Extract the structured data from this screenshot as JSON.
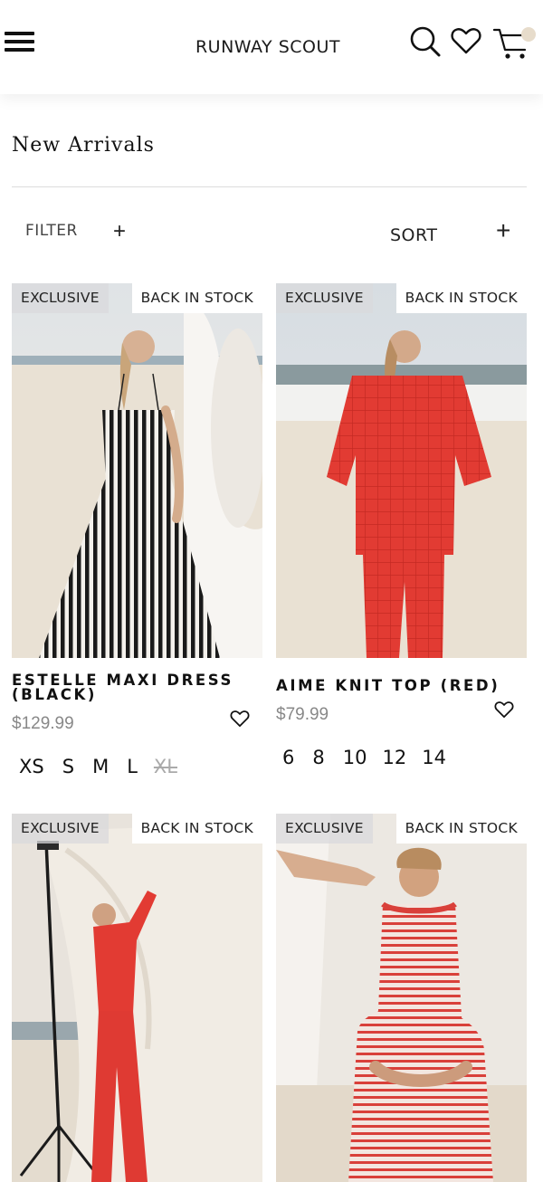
{
  "header": {
    "logo": "RUNWAY SCOUT",
    "icons": [
      "menu-icon",
      "search-icon",
      "heart-icon",
      "cart-icon"
    ]
  },
  "page": {
    "title": "New Arrivals",
    "filter_label": "FILTER",
    "filter_icon": "+",
    "sort_label": "SORT",
    "sort_icon": "+"
  },
  "products": [
    {
      "name": "ESTELLE MAXI DRESS (BLACK)",
      "price": "$129.99",
      "badge_left": "EXCLUSIVE",
      "badge_right": "BACK IN STOCK",
      "sizes": [
        {
          "label": "XS",
          "available": true
        },
        {
          "label": "S",
          "available": true
        },
        {
          "label": "M",
          "available": true
        },
        {
          "label": "L",
          "available": true
        },
        {
          "label": "XL",
          "available": false
        }
      ]
    },
    {
      "name": "AIME KNIT TOP (RED)",
      "price": "$79.99",
      "badge_left": "EXCLUSIVE",
      "badge_right": "BACK IN STOCK",
      "sizes": [
        {
          "label": "6",
          "available": true
        },
        {
          "label": "8",
          "available": true
        },
        {
          "label": "10",
          "available": true
        },
        {
          "label": "12",
          "available": true
        },
        {
          "label": "14",
          "available": true
        }
      ]
    },
    {
      "badge_left": "EXCLUSIVE",
      "badge_right": "BACK IN STOCK"
    },
    {
      "badge_left": "EXCLUSIVE",
      "badge_right": "BACK IN STOCK"
    }
  ],
  "colors": {
    "accent_red": "#e23b33",
    "cart_dot": "#e7dccb",
    "price_grey": "#888888"
  }
}
